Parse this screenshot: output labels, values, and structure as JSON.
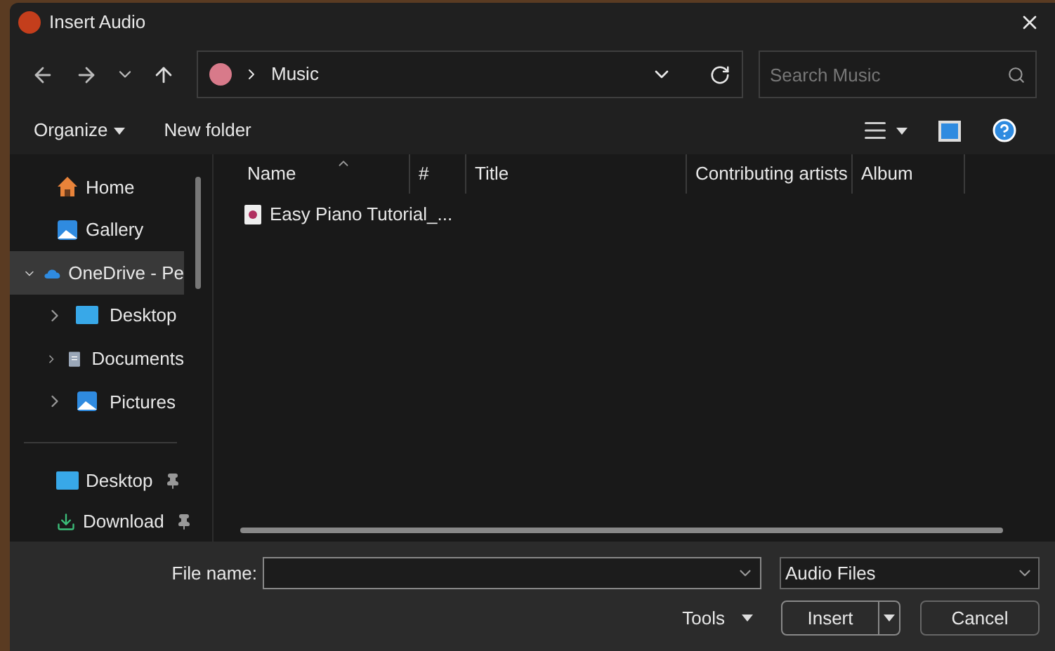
{
  "window": {
    "title": "Insert Audio"
  },
  "address": {
    "path": [
      "Music"
    ]
  },
  "search": {
    "placeholder": "Search Music"
  },
  "toolbar": {
    "organize": "Organize",
    "new_folder": "New folder"
  },
  "sidebar": {
    "items": [
      {
        "label": "Home",
        "kind": "home",
        "selected": false
      },
      {
        "label": "Gallery",
        "kind": "gallery",
        "selected": false
      },
      {
        "label": "OneDrive - Pe",
        "kind": "cloud",
        "selected": true,
        "expanded": true,
        "children": [
          {
            "label": "Desktop",
            "kind": "desktop",
            "selected": false,
            "expanded": false
          },
          {
            "label": "Documents",
            "kind": "documents",
            "selected": false,
            "expanded": false
          },
          {
            "label": "Pictures",
            "kind": "gallery",
            "selected": false,
            "expanded": false
          }
        ]
      }
    ],
    "pinned": [
      {
        "label": "Desktop",
        "kind": "desktop",
        "pinned": true
      },
      {
        "label": "Download",
        "kind": "download",
        "pinned": true
      }
    ]
  },
  "table": {
    "columns": [
      "Name",
      "#",
      "Title",
      "Contributing artists",
      "Album"
    ],
    "rows": [
      {
        "name": "Easy Piano Tutorial_..."
      }
    ]
  },
  "footer": {
    "file_name_label": "File name:",
    "file_type": "Audio Files",
    "tools": "Tools",
    "insert": "Insert",
    "cancel": "Cancel"
  }
}
